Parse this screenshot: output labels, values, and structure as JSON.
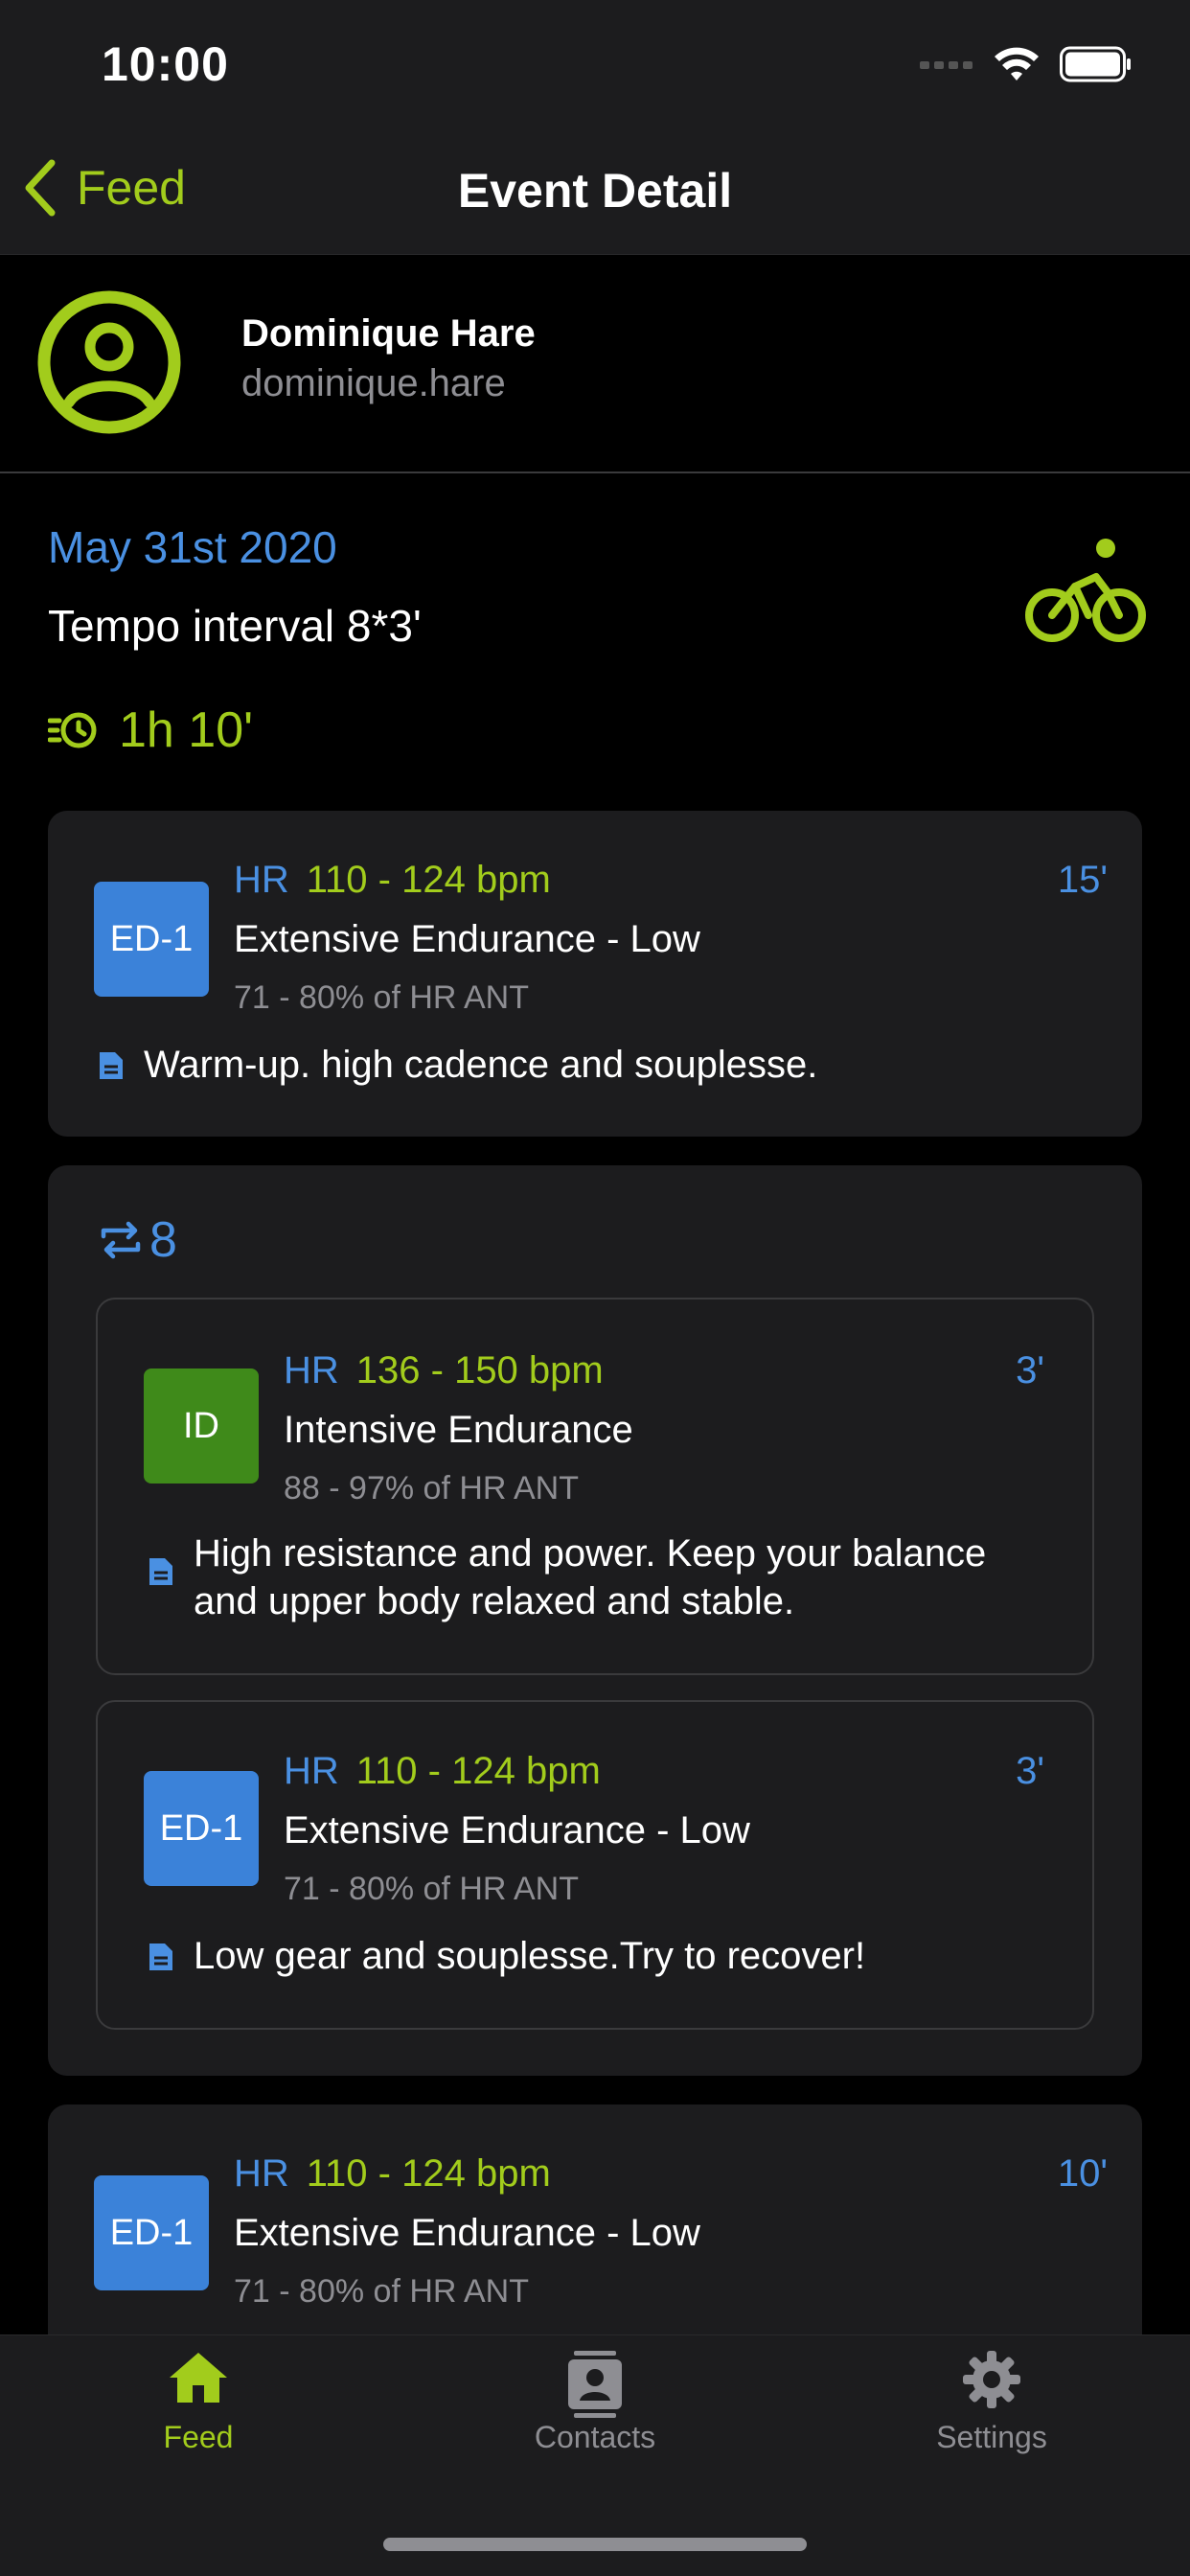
{
  "status": {
    "time": "10:00"
  },
  "nav": {
    "back_label": "Feed",
    "title": "Event Detail"
  },
  "user": {
    "name": "Dominique Hare",
    "handle": "dominique.hare"
  },
  "event": {
    "date": "May 31st 2020",
    "title": "Tempo interval 8*3'",
    "duration": "1h 10'",
    "sport_icon": "cycling-icon"
  },
  "steps": {
    "warmup": {
      "badge": "ED-1",
      "badge_color": "#3b82d9",
      "hr_label": "HR",
      "hr_range": "110 - 124 bpm",
      "duration": "15'",
      "zone_name": "Extensive Endurance - Low",
      "zone_pct": "71 - 80% of HR ANT",
      "note": "Warm-up. high cadence and souplesse."
    },
    "repeat": {
      "count": "8",
      "items": [
        {
          "badge": "ID",
          "badge_color": "#3f8a1a",
          "hr_label": "HR",
          "hr_range": "136 - 150 bpm",
          "duration": "3'",
          "zone_name": "Intensive Endurance",
          "zone_pct": "88 - 97% of HR ANT",
          "note_line1": "High resistance and power. Keep your balance",
          "note_line2": "and upper body relaxed and stable."
        },
        {
          "badge": "ED-1",
          "badge_color": "#3b82d9",
          "hr_label": "HR",
          "hr_range": "110 - 124 bpm",
          "duration": "3'",
          "zone_name": "Extensive Endurance - Low",
          "zone_pct": "71 - 80% of HR ANT",
          "note": "Low gear and souplesse.Try to recover!"
        }
      ]
    },
    "cooldown": {
      "badge": "ED-1",
      "badge_color": "#3b82d9",
      "hr_label": "HR",
      "hr_range": "110 - 124 bpm",
      "duration": "10'",
      "zone_name": "Extensive Endurance - Low",
      "zone_pct": "71 - 80% of HR ANT"
    }
  },
  "tabs": [
    {
      "label": "Feed",
      "icon": "home-icon",
      "active": true
    },
    {
      "label": "Contacts",
      "icon": "contacts-icon",
      "active": false
    },
    {
      "label": "Settings",
      "icon": "gear-icon",
      "active": false
    }
  ],
  "colors": {
    "accent": "#a2cc1c",
    "link": "#4a90e2",
    "inactive": "#8e8e93"
  }
}
